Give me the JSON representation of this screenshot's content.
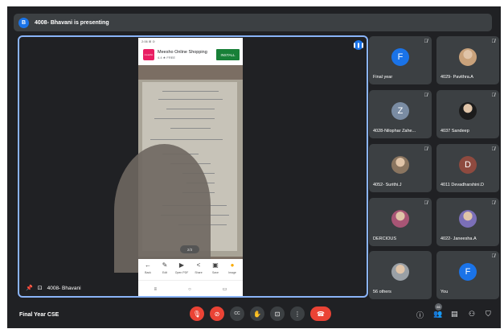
{
  "presentation_banner": {
    "avatar_letter": "B",
    "text": "4008- Bhavani is presenting"
  },
  "main_stage": {
    "presenter_name": "4008- Bhavani"
  },
  "phone_screen": {
    "status": "2:06 ⊞ ⊙",
    "ad": {
      "logo_text": "meesho",
      "title": "Meesho Online Shopping",
      "rating": "4.4 ★ FREE",
      "install_label": "INSTALL"
    },
    "page_indicator": "2/3",
    "tools": [
      {
        "glyph": "←",
        "label": "Back"
      },
      {
        "glyph": "✎",
        "label": "Edit"
      },
      {
        "glyph": "▶",
        "label": "Open PDF"
      },
      {
        "glyph": "<",
        "label": "Share"
      },
      {
        "glyph": "▣",
        "label": "Save"
      },
      {
        "glyph": "●",
        "label": "Image"
      }
    ],
    "nav": [
      "≡",
      "○",
      "▭"
    ]
  },
  "participants": [
    {
      "name": "Final year",
      "letter": "F",
      "color": "#1a73e8",
      "muted": true,
      "photo": false
    },
    {
      "name": "4029- Pavithra.A",
      "letter": "",
      "color": "#c9a27b",
      "muted": true,
      "photo": true
    },
    {
      "name": "4028-Nilophar Zahe...",
      "letter": "Z",
      "color": "#7a8ca3",
      "muted": true,
      "photo": false
    },
    {
      "name": "4037 Sandeep",
      "letter": "",
      "color": "#1c1c1c",
      "muted": true,
      "photo": true
    },
    {
      "name": "4052- Surithi.J",
      "letter": "",
      "color": "#8a7560",
      "muted": true,
      "photo": true
    },
    {
      "name": "4011 Devadharshini.D",
      "letter": "D",
      "color": "#8e4a3f",
      "muted": true,
      "photo": false
    },
    {
      "name": "DERCIOUS",
      "letter": "",
      "color": "#a85575",
      "muted": true,
      "photo": true
    },
    {
      "name": "4022- Janeesha.A",
      "letter": "",
      "color": "#7b6fb8",
      "muted": true,
      "photo": true
    },
    {
      "name": "56 others",
      "letter": "",
      "color": "#9aa0a6",
      "muted": false,
      "photo": true
    },
    {
      "name": "You",
      "letter": "F",
      "color": "#1a73e8",
      "muted": true,
      "photo": false
    }
  ],
  "bottom_bar": {
    "meeting_title": "Final Year CSE",
    "people_count": "66",
    "controls": [
      {
        "name": "mic-off-button",
        "glyph": "🎙",
        "red": true
      },
      {
        "name": "camera-off-button",
        "glyph": "⊘",
        "red": true
      },
      {
        "name": "captions-button",
        "glyph": "CC",
        "red": false
      },
      {
        "name": "raise-hand-button",
        "glyph": "✋",
        "red": false
      },
      {
        "name": "present-button",
        "glyph": "⊡",
        "red": false
      },
      {
        "name": "more-options-button",
        "glyph": "⋮",
        "red": false
      }
    ],
    "leave_glyph": "☎",
    "right_icons": [
      "ⓘ",
      "👥",
      "▤",
      "⚇",
      "⛉"
    ]
  }
}
